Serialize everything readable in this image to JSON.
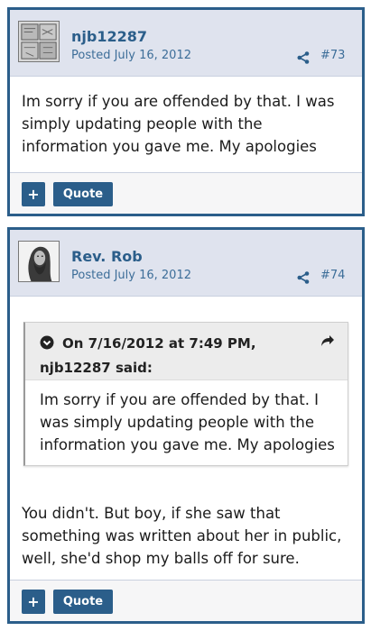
{
  "posts": [
    {
      "username": "njb12287",
      "posted": "Posted July 16, 2012",
      "number": "#73",
      "body": "Im sorry if you are offended by that. I was simply updating people with the information you gave me. My apologies",
      "plus_label": "+",
      "quote_label": "Quote"
    },
    {
      "username": "Rev. Rob",
      "posted": "Posted July 16, 2012",
      "number": "#74",
      "quote": {
        "date": "On 7/16/2012 at 7:49 PM,",
        "author": "njb12287 said:",
        "text": "Im sorry if you are offended by that. I was simply updating people with the information you gave me. My apologies"
      },
      "body": "You didn't. But boy, if she saw that something was written about her in public, well, she'd shop my balls off for sure.",
      "plus_label": "+",
      "quote_label": "Quote"
    }
  ],
  "colors": {
    "accent": "#2b5e8a",
    "header_bg": "#dfe3ee",
    "link": "#3d6e99"
  },
  "icons": {
    "share": "share-icon",
    "expand": "chevron-circle-down-icon",
    "goto": "reply-arrow-icon"
  }
}
